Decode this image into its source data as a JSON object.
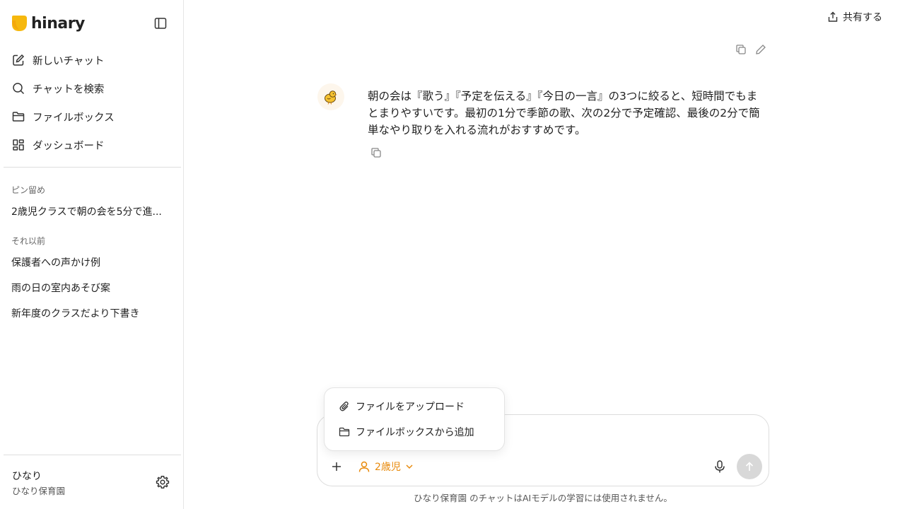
{
  "brand": {
    "name": "hinary",
    "accent": "#f6b80e"
  },
  "sidebar": {
    "nav": [
      {
        "label": "新しいチャット",
        "icon": "compose-icon"
      },
      {
        "label": "チャットを検索",
        "icon": "search-icon"
      },
      {
        "label": "ファイルボックス",
        "icon": "folder-icon"
      },
      {
        "label": "ダッシュボード",
        "icon": "dashboard-icon"
      }
    ],
    "pinned_label": "ピン留め",
    "pinned": [
      "2歳児クラスで朝の会を5分で進..."
    ],
    "earlier_label": "それ以前",
    "earlier": [
      "保護者への声かけ例",
      "雨の日の室内あそび案",
      "新年度のクラスだより下書き"
    ],
    "user": {
      "name": "ひなり",
      "org": "ひなり保育園"
    }
  },
  "header": {
    "share_label": "共有する"
  },
  "message": {
    "text": "朝の会は『歌う』『予定を伝える』『今日の一言』の3つに絞ると、短時間でもまとまりやすいです。最初の1分で季節の歌、次の2分で予定確認、最後の2分で簡単なやり取りを入れる流れがおすすめです。"
  },
  "composer": {
    "age_label": "2歳児",
    "accent": "#e88a0c",
    "menu": [
      {
        "label": "ファイルをアップロード",
        "icon": "paperclip-icon"
      },
      {
        "label": "ファイルボックスから追加",
        "icon": "folder-icon"
      }
    ]
  },
  "disclaimer": "ひなり保育園 のチャットはAIモデルの学習には使用されません。"
}
